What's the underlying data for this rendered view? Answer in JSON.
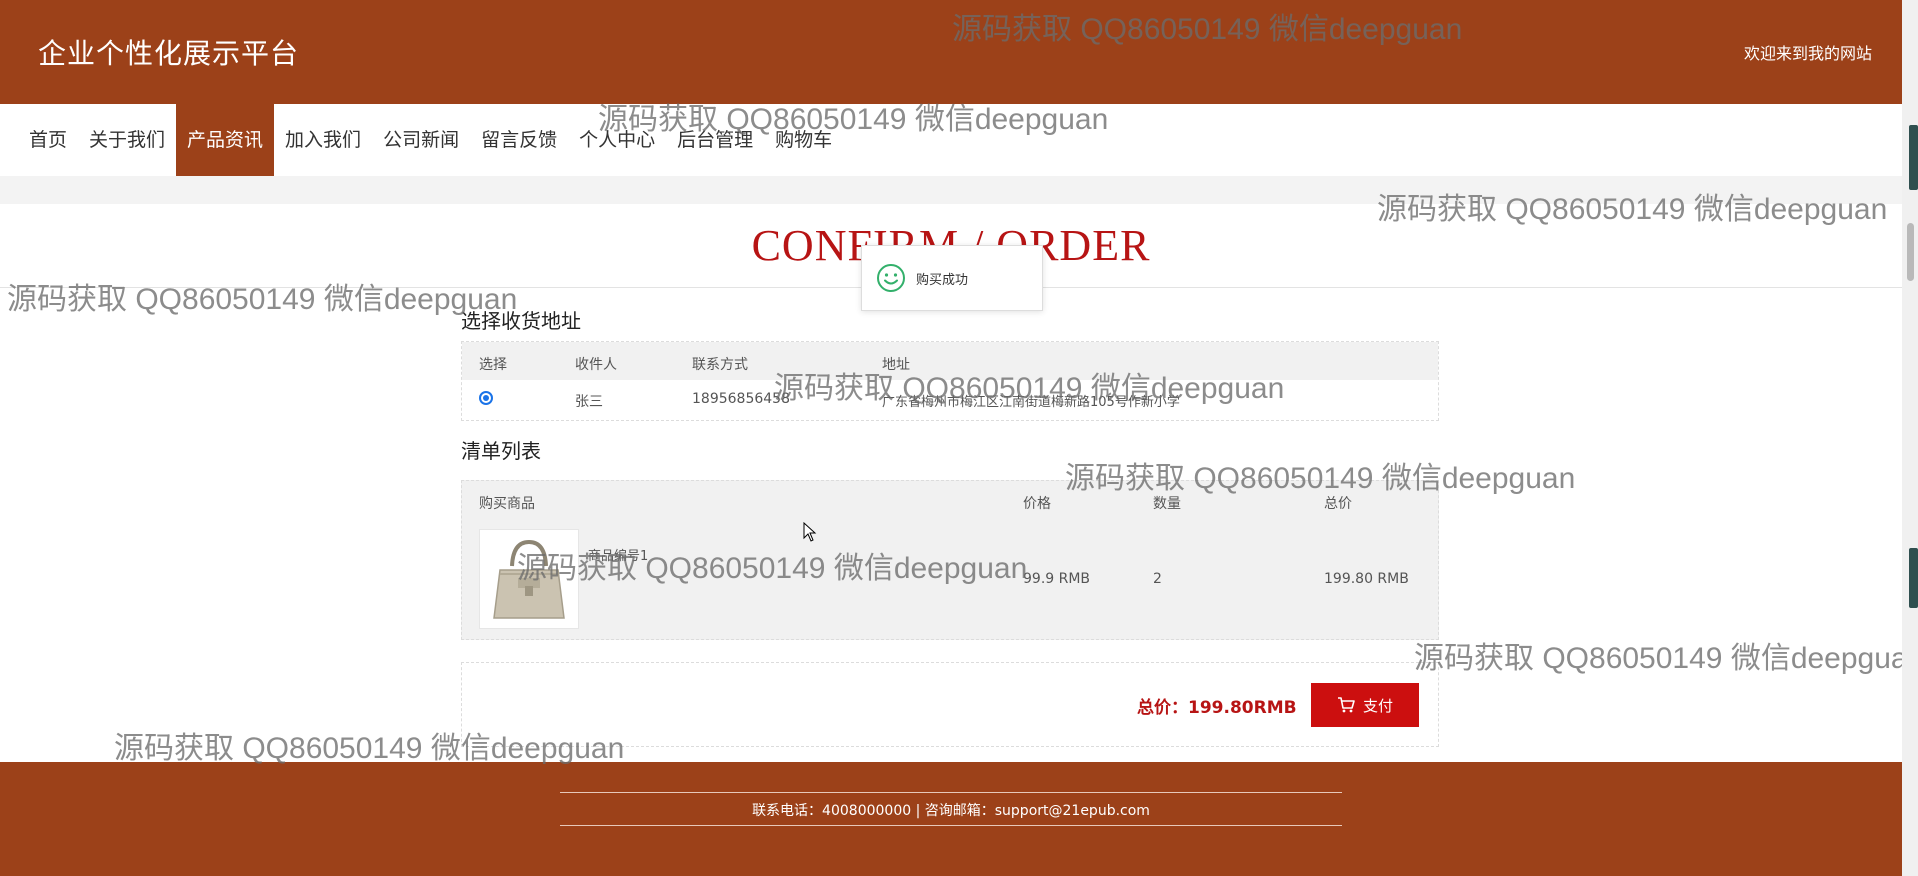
{
  "header": {
    "site_title": "企业个性化展示平台",
    "welcome": "欢迎来到我的网站"
  },
  "nav": {
    "items": [
      {
        "label": "首页"
      },
      {
        "label": "关于我们"
      },
      {
        "label": "产品资讯",
        "active": true
      },
      {
        "label": "加入我们"
      },
      {
        "label": "公司新闻"
      },
      {
        "label": "留言反馈"
      },
      {
        "label": "个人中心"
      },
      {
        "label": "后台管理"
      },
      {
        "label": "购物车"
      }
    ]
  },
  "page_title": "CONFIRM / ORDER",
  "toast": {
    "message": "购买成功",
    "icon": "smile-icon"
  },
  "address_section": {
    "title": "选择收货地址",
    "headers": {
      "select": "选择",
      "receiver": "收件人",
      "contact": "联系方式",
      "address": "地址"
    },
    "rows": [
      {
        "selected": true,
        "receiver": "张三",
        "contact": "18956856458",
        "address": "广东省梅州市梅江区江南街道梅新路105号作新小学"
      }
    ]
  },
  "list_section": {
    "title": "清单列表",
    "headers": {
      "product": "购买商品",
      "price": "价格",
      "qty": "数量",
      "total": "总价"
    },
    "rows": [
      {
        "name": "商品编号1",
        "price": "99.9 RMB",
        "qty": "2",
        "total": "199.80 RMB",
        "image": "handbag-image"
      }
    ]
  },
  "payment": {
    "total_label": "总价：199.80RMB",
    "pay_label": "支付",
    "pay_icon": "cart-icon"
  },
  "footer": {
    "contact": "联系电话：4008000000 | 咨询邮箱：support@21epub.com"
  },
  "watermark": "源码获取 QQ86050149 微信deepguan",
  "colors": {
    "brand": "#9c4119",
    "accent": "#b71414",
    "pay_button": "#cc0f0f"
  }
}
